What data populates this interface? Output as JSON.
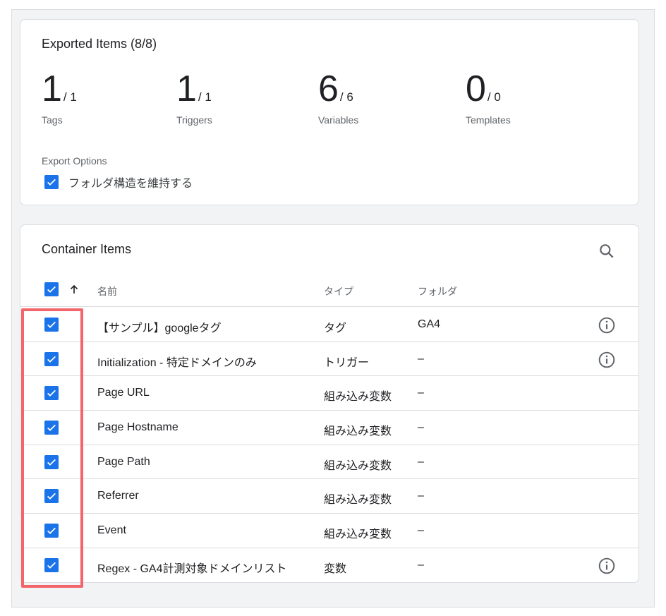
{
  "export_summary": {
    "title": "Exported Items (8/8)",
    "stats": [
      {
        "value": "1",
        "total": "/ 1",
        "label": "Tags"
      },
      {
        "value": "1",
        "total": "/ 1",
        "label": "Triggers"
      },
      {
        "value": "6",
        "total": "/ 6",
        "label": "Variables"
      },
      {
        "value": "0",
        "total": "/ 0",
        "label": "Templates"
      }
    ],
    "export_options_label": "Export Options",
    "keep_folder_structure": {
      "label": "フォルダ構造を維持する",
      "checked": true
    }
  },
  "container_items": {
    "title": "Container Items",
    "columns": {
      "name": "名前",
      "type": "タイプ",
      "folder": "フォルダ"
    },
    "rows": [
      {
        "name": "【サンプル】googleタグ",
        "type": "タグ",
        "folder": "GA4",
        "info": true
      },
      {
        "name": "Initialization - 特定ドメインのみ",
        "type": "トリガー",
        "folder": "–",
        "info": true
      },
      {
        "name": "Page URL",
        "type": "組み込み変数",
        "folder": "–",
        "info": false
      },
      {
        "name": "Page Hostname",
        "type": "組み込み変数",
        "folder": "–",
        "info": false
      },
      {
        "name": "Page Path",
        "type": "組み込み変数",
        "folder": "–",
        "info": false
      },
      {
        "name": "Referrer",
        "type": "組み込み変数",
        "folder": "–",
        "info": false
      },
      {
        "name": "Event",
        "type": "組み込み変数",
        "folder": "–",
        "info": false
      },
      {
        "name": "Regex - GA4計測対象ドメインリスト",
        "type": "変数",
        "folder": "–",
        "info": true
      }
    ]
  },
  "colors": {
    "accent": "#1a73e8",
    "highlight": "#f2666b"
  }
}
